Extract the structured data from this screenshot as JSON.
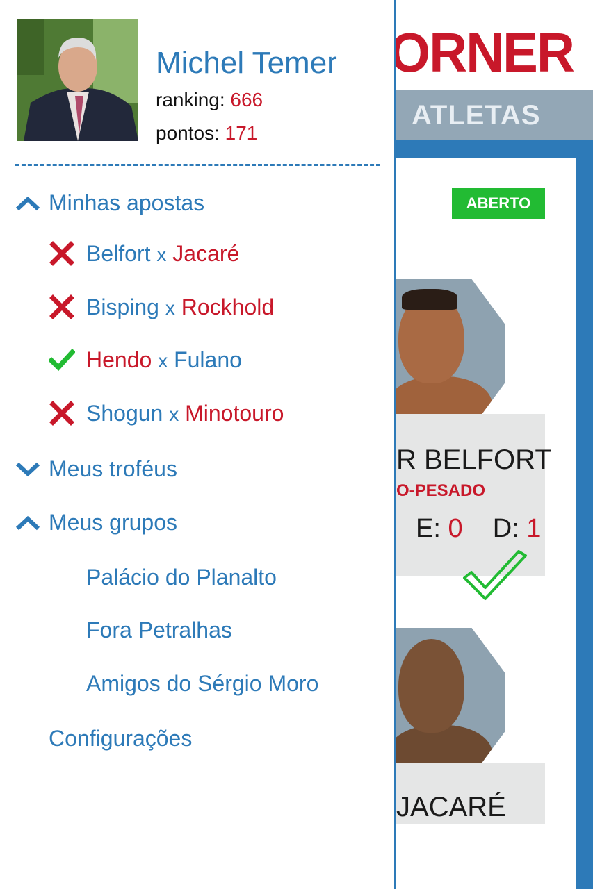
{
  "background": {
    "logo_text": "ORNER",
    "tab_label": "ATLETAS",
    "status_badge": "ABERTO",
    "fighters": [
      {
        "name": "R BELFORT",
        "weight_class": "O-PESADO",
        "stat_e_label": "E:",
        "stat_e_value": "0",
        "stat_d_label": "D:",
        "stat_d_value": "1"
      },
      {
        "name": "JACARÉ"
      }
    ]
  },
  "profile": {
    "name": "Michel Temer",
    "ranking_label": "ranking:",
    "ranking_value": "666",
    "points_label": "pontos:",
    "points_value": "171"
  },
  "menu": {
    "my_bets": {
      "label": "Minhas apostas",
      "expanded": true,
      "items": [
        {
          "left": "Belfort",
          "sep": "x",
          "right": "Jacaré",
          "result": "wrong",
          "picked": "right"
        },
        {
          "left": "Bisping",
          "sep": "x",
          "right": "Rockhold",
          "result": "wrong",
          "picked": "right"
        },
        {
          "left": "Hendo",
          "sep": "x",
          "right": "Fulano",
          "result": "correct",
          "picked": "left"
        },
        {
          "left": "Shogun",
          "sep": "x",
          "right": "Minotouro",
          "result": "wrong",
          "picked": "right"
        }
      ]
    },
    "my_trophies": {
      "label": "Meus troféus",
      "expanded": false
    },
    "my_groups": {
      "label": "Meus grupos",
      "expanded": true,
      "items": [
        "Palácio do Planalto",
        "Fora Petralhas",
        "Amigos do Sérgio Moro"
      ]
    },
    "settings_label": "Configurações"
  },
  "colors": {
    "accent_blue": "#2d7ab8",
    "accent_red": "#c8182a",
    "success_green": "#22bb33",
    "tab_gray": "#93a7b6"
  }
}
